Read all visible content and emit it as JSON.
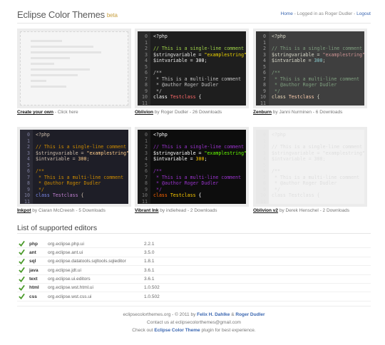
{
  "header": {
    "logo": "Eclipse Color Themes",
    "beta": "beta",
    "nav_home": "Home",
    "nav_sep": " - ",
    "nav_logged": "Logged in as Roger Dudler",
    "nav_logout": "Logout"
  },
  "code_lines": [
    "<?php",
    "",
    "// This is a single-line comment",
    "$stringvariable = \"examplestring\";",
    "$intvariable = 300;",
    "",
    "/**",
    " * This is a multi-line comment",
    " * @author Roger Dudler",
    " */",
    "class Testclass {",
    ""
  ],
  "line_numbers": [
    "0",
    "1",
    "2",
    "3",
    "4",
    "5",
    "6",
    "7",
    "8",
    "9",
    "10",
    "11"
  ],
  "themes": [
    {
      "name": "Create your own",
      "byline": " - Click here"
    },
    {
      "name": "Oblivion",
      "byline": " by Roger Dudler - 26 Downloads"
    },
    {
      "name": "Zenburn",
      "byline": " by Janni Nurminen - 6 Downloads"
    },
    {
      "name": "Inkpot",
      "byline": " by Ciaran McCreesh - 5 Downloads"
    },
    {
      "name": "Vibrant Ink",
      "byline": " by indiehead - 2 Downloads"
    },
    {
      "name": "Oblivion v2",
      "byline": " by Derek Henschel - 2 Downloads"
    }
  ],
  "editors_title": "List of supported editors",
  "editors": [
    {
      "name": "php",
      "plugin": "org.eclipse.php.ui",
      "version": "2.2.1"
    },
    {
      "name": "ant",
      "plugin": "org.eclipse.ant.ui",
      "version": "3.5.0"
    },
    {
      "name": "sql",
      "plugin": "org.eclipse.datatools.sqltools.sqleditor",
      "version": "1.8.1"
    },
    {
      "name": "java",
      "plugin": "org.eclipse.jdt.ui",
      "version": "3.6.1"
    },
    {
      "name": "text",
      "plugin": "org.eclipse.ui.editors",
      "version": "3.6.1"
    },
    {
      "name": "html",
      "plugin": "org.eclipse.wst.html.ui",
      "version": "1.0.502"
    },
    {
      "name": "css",
      "plugin": "org.eclipse.wst.css.ui",
      "version": "1.0.502"
    }
  ],
  "footer": {
    "line1_pre": "eclipsecolorthemes.org - © 2011 by ",
    "author1": "Felix H. Dahlke",
    "amp": " & ",
    "author2": "Roger Dudler",
    "line2": "Contact us at eclipsecolorthemes@gmail.com",
    "line3_pre": "Check out ",
    "plugin_link": "Eclipse Color Theme",
    "line3_post": " plugin for best experience."
  },
  "colors": {
    "link": "#3a66b0",
    "check": "#4a9a2a",
    "oblivion_bg": "#1e1e1e",
    "zenburn_bg": "#3f3f3f",
    "inkpot_bg": "#1e1e27",
    "vibrant_bg": "#0d0d0d"
  }
}
